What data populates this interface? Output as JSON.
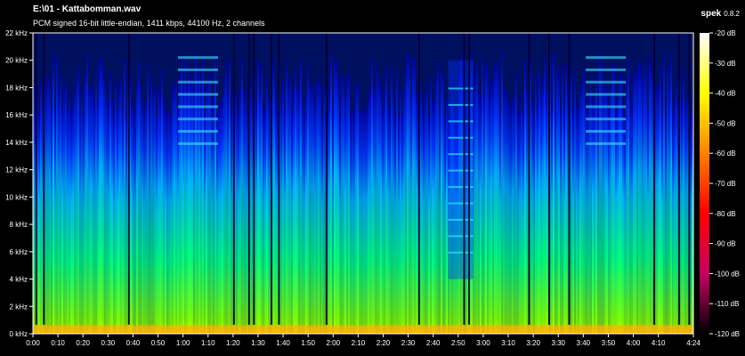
{
  "header": {
    "title": "E:\\01 - Kattabomman.wav",
    "subtitle": "PCM signed 16-bit little-endian, 1411 kbps, 44100 Hz, 2 channels"
  },
  "brand": {
    "name": "spek",
    "version": "0.8.2"
  },
  "chart_data": {
    "type": "heatmap",
    "title": "E:\\01 - Kattabomman.wav",
    "subtitle": "PCM signed 16-bit little-endian, 1411 kbps, 44100 Hz, 2 channels",
    "y_ticks": [
      "0 kHz",
      "2 kHz",
      "4 kHz",
      "6 kHz",
      "8 kHz",
      "10 kHz",
      "12 kHz",
      "14 kHz",
      "16 kHz",
      "18 kHz",
      "20 kHz",
      "22 kHz"
    ],
    "ylim_khz": [
      0,
      22
    ],
    "x_ticks": [
      "0:00",
      "0:10",
      "0:20",
      "0:30",
      "0:40",
      "0:50",
      "1:00",
      "1:10",
      "1:20",
      "1:30",
      "1:40",
      "1:50",
      "2:00",
      "2:10",
      "2:20",
      "2:30",
      "2:40",
      "2:50",
      "3:00",
      "3:10",
      "3:20",
      "3:30",
      "3:40",
      "3:50",
      "4:00",
      "4:10"
    ],
    "x_end_label": "4:24",
    "xlim_seconds": [
      0,
      264
    ],
    "colorbar_ticks": [
      "-20 dB",
      "-30 dB",
      "-40 dB",
      "-50 dB",
      "-60 dB",
      "-70 dB",
      "-80 dB",
      "-90 dB",
      "-100 dB",
      "-110 dB",
      "-120 dB"
    ],
    "db_range": [
      -120,
      -20
    ],
    "colormap": [
      "#ffffff",
      "#ffff00",
      "#ff8000",
      "#ff0000",
      "#c80064",
      "#000000"
    ],
    "spectral_colors": [
      "#0000a0",
      "#0033ff",
      "#00b4ff",
      "#00ff80",
      "#80ff00",
      "#ffe000"
    ],
    "vertical_bands_seconds": [
      {
        "start": 58,
        "end": 74,
        "kind": "bright-high",
        "level": 0.6
      },
      {
        "start": 166,
        "end": 176,
        "kind": "dark-high",
        "level": 0.4
      },
      {
        "start": 221,
        "end": 237,
        "kind": "bright-high",
        "level": 0.6
      }
    ],
    "dark_lines_seconds": [
      1,
      4,
      38,
      80,
      86,
      88,
      95,
      98,
      117,
      154,
      172,
      174,
      198,
      206,
      214,
      248,
      258,
      262
    ]
  }
}
